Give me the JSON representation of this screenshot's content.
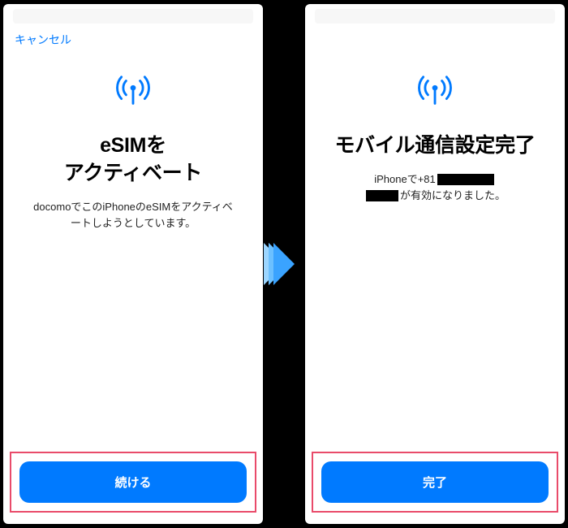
{
  "colors": {
    "accent": "#007aff",
    "highlight_border": "#e94b6a"
  },
  "icon_name": "cellular-signal-icon",
  "arrow_name": "next-step-arrow",
  "left": {
    "cancel": "キャンセル",
    "title": "eSIMを\nアクティベート",
    "subtitle": "docomoでこのiPhoneのeSIMをアクティベートしようとしています。",
    "button": "続ける"
  },
  "right": {
    "title": "モバイル通信設定完了",
    "subtitle_prefix": "iPhoneで+81",
    "subtitle_suffix": "が有効になりました。",
    "button": "完了"
  }
}
